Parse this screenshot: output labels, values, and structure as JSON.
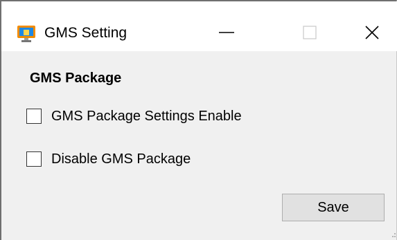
{
  "window": {
    "title": "GMS Setting",
    "app_icon": "monitor-app-icon",
    "caption_buttons": {
      "minimize_icon": "minimize-icon",
      "maximize_icon": "maximize-icon",
      "close_icon": "close-icon"
    }
  },
  "section": {
    "title": "GMS Package"
  },
  "options": [
    {
      "label": "GMS Package Settings Enable",
      "checked": false
    },
    {
      "label": "Disable GMS Package",
      "checked": false
    }
  ],
  "actions": {
    "save_label": "Save"
  },
  "colors": {
    "titlebar_bg": "#ffffff",
    "body_bg": "#f0f0f0",
    "button_bg": "#e1e1e1",
    "button_border": "#adadad",
    "icon_orange": "#f28c00",
    "icon_blue": "#1e88e5"
  }
}
